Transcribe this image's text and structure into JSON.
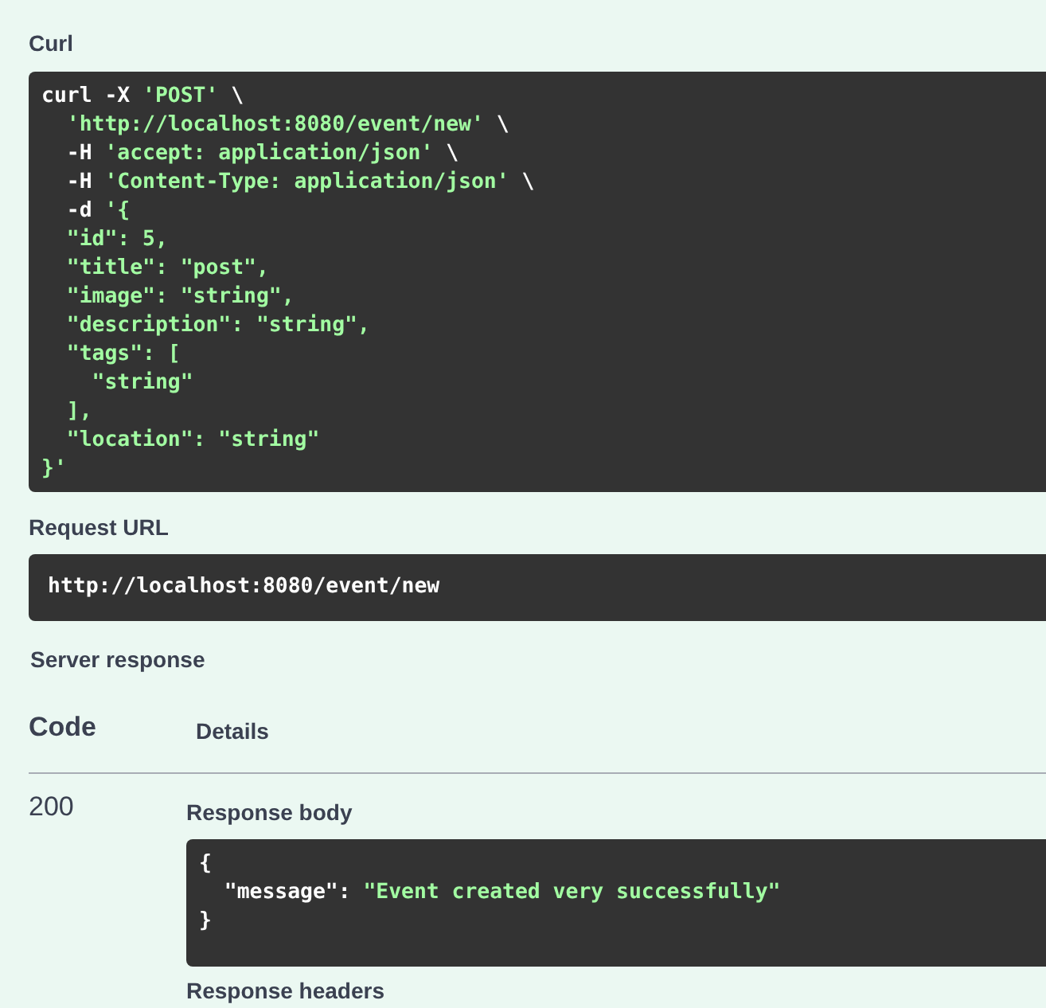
{
  "curl": {
    "label": "Curl",
    "lines": [
      [
        {
          "kind": "plain",
          "text": "curl -X "
        },
        {
          "kind": "string",
          "text": "'POST'"
        },
        {
          "kind": "plain",
          "text": " \\"
        }
      ],
      [
        {
          "kind": "string",
          "text": "  'http://localhost:8080/event/new'"
        },
        {
          "kind": "plain",
          "text": " \\"
        }
      ],
      [
        {
          "kind": "plain",
          "text": "  -H "
        },
        {
          "kind": "string",
          "text": "'accept: application/json'"
        },
        {
          "kind": "plain",
          "text": " \\"
        }
      ],
      [
        {
          "kind": "plain",
          "text": "  -H "
        },
        {
          "kind": "string",
          "text": "'Content-Type: application/json'"
        },
        {
          "kind": "plain",
          "text": " \\"
        }
      ],
      [
        {
          "kind": "plain",
          "text": "  -d "
        },
        {
          "kind": "string",
          "text": "'{"
        }
      ],
      [
        {
          "kind": "string",
          "text": "  \"id\": 5,"
        }
      ],
      [
        {
          "kind": "string",
          "text": "  \"title\": \"post\","
        }
      ],
      [
        {
          "kind": "string",
          "text": "  \"image\": \"string\","
        }
      ],
      [
        {
          "kind": "string",
          "text": "  \"description\": \"string\","
        }
      ],
      [
        {
          "kind": "string",
          "text": "  \"tags\": ["
        }
      ],
      [
        {
          "kind": "string",
          "text": "    \"string\""
        }
      ],
      [
        {
          "kind": "string",
          "text": "  ],"
        }
      ],
      [
        {
          "kind": "string",
          "text": "  \"location\": \"string\""
        }
      ],
      [
        {
          "kind": "string",
          "text": "}'"
        }
      ]
    ]
  },
  "request_url": {
    "label": "Request URL",
    "url": "http://localhost:8080/event/new"
  },
  "server_response": {
    "label": "Server response",
    "columns": [
      "Code",
      "Details"
    ],
    "rows": [
      {
        "code": "200",
        "response_body": {
          "label": "Response body",
          "lines": [
            [
              {
                "kind": "plain",
                "text": "{"
              }
            ],
            [
              {
                "kind": "plain",
                "text": "  \"message\": "
              },
              {
                "kind": "string",
                "text": "\"Event created very successfully\""
              }
            ],
            [
              {
                "kind": "plain",
                "text": "}"
              }
            ]
          ]
        },
        "next_label": "Response headers"
      }
    ]
  }
}
